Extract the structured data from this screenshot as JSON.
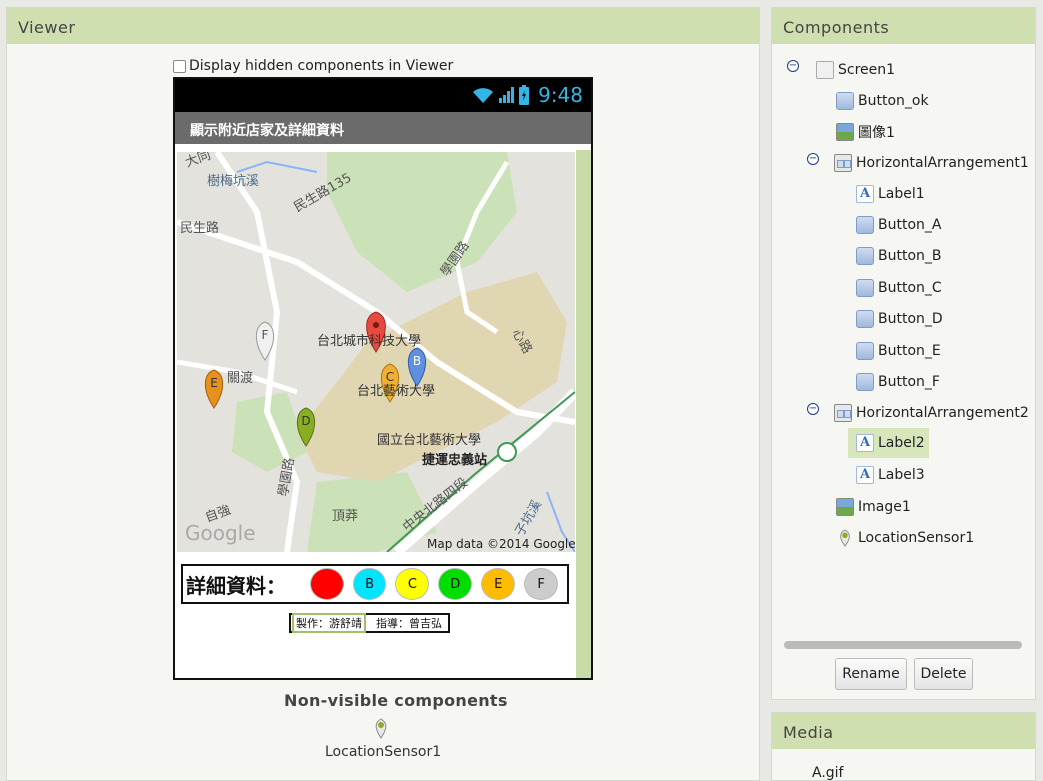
{
  "viewer": {
    "title": "Viewer",
    "hidden_toggle_label": "Display hidden components in Viewer",
    "phone": {
      "time": "9:48",
      "screen_title": "顯示附近店家及詳細資料",
      "map": {
        "labels": [
          "樹梅坑溪",
          "民生路",
          "民生路135",
          "大同",
          "學園路",
          "台北城市科技大學",
          "台北藝術大學",
          "國立台北藝術大學",
          "捷運忠義站",
          "中央北路四段",
          "學園路",
          "頂莽",
          "自強",
          "子坑溪",
          "關渡",
          "心路"
        ],
        "attribution": "Map data ©2014 Google",
        "logo": "Google",
        "markers": [
          {
            "letter": "",
            "color": "#e64a3f"
          },
          {
            "letter": "B",
            "color": "#5e8fe0"
          },
          {
            "letter": "C",
            "color": "#f0b030"
          },
          {
            "letter": "D",
            "color": "#8aae22"
          },
          {
            "letter": "E",
            "color": "#e8901c"
          },
          {
            "letter": "F",
            "color": "#f0f0f0"
          }
        ]
      },
      "detail_label": "詳細資料：",
      "detail_buttons": [
        {
          "label": "",
          "color": "#ff0000"
        },
        {
          "label": "B",
          "color": "#00e5ff"
        },
        {
          "label": "C",
          "color": "#ffff00"
        },
        {
          "label": "D",
          "color": "#00dd00"
        },
        {
          "label": "E",
          "color": "#ffbb00"
        },
        {
          "label": "F",
          "color": "#cccccc"
        }
      ],
      "credit_author": "製作：游舒靖",
      "credit_advisor": "指導：曾吉弘"
    },
    "nonvisible_title": "Non-visible components",
    "nonvisible_items": [
      "LocationSensor1"
    ]
  },
  "components": {
    "title": "Components",
    "tree": [
      {
        "label": "Screen1",
        "icon": "screen-icon",
        "collapsible": true
      },
      {
        "label": "Button_ok",
        "icon": "button-icon"
      },
      {
        "label": "圖像1",
        "icon": "image-icon"
      },
      {
        "label": "HorizontalArrangement1",
        "icon": "horizontal-arrangement-icon",
        "collapsible": true
      },
      {
        "label": "Label1",
        "icon": "label-icon"
      },
      {
        "label": "Button_A",
        "icon": "button-icon"
      },
      {
        "label": "Button_B",
        "icon": "button-icon"
      },
      {
        "label": "Button_C",
        "icon": "button-icon"
      },
      {
        "label": "Button_D",
        "icon": "button-icon"
      },
      {
        "label": "Button_E",
        "icon": "button-icon"
      },
      {
        "label": "Button_F",
        "icon": "button-icon"
      },
      {
        "label": "HorizontalArrangement2",
        "icon": "horizontal-arrangement-icon",
        "collapsible": true
      },
      {
        "label": "Label2",
        "icon": "label-icon",
        "selected": true
      },
      {
        "label": "Label3",
        "icon": "label-icon"
      },
      {
        "label": "Image1",
        "icon": "image-icon"
      },
      {
        "label": "LocationSensor1",
        "icon": "location-icon"
      }
    ],
    "rename_label": "Rename",
    "delete_label": "Delete"
  },
  "media": {
    "title": "Media",
    "items": [
      "A.gif"
    ]
  }
}
